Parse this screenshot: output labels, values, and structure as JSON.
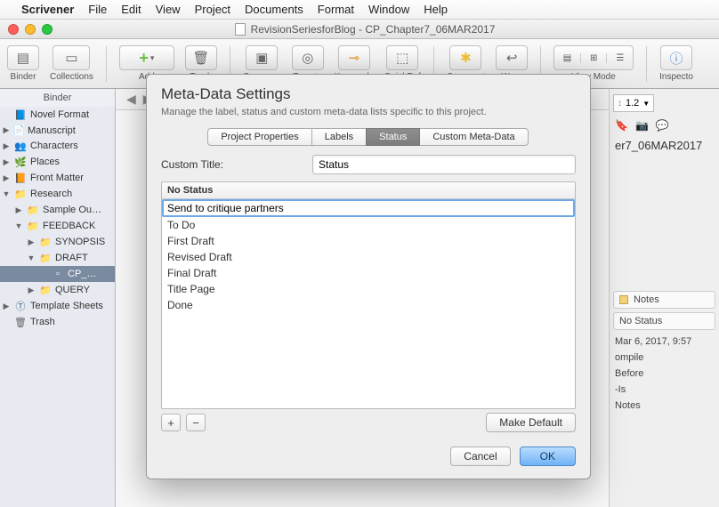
{
  "menubar": {
    "app": "Scrivener",
    "items": [
      "File",
      "Edit",
      "View",
      "Project",
      "Documents",
      "Format",
      "Window",
      "Help"
    ]
  },
  "window_title": "RevisionSeriesforBlog - CP_Chapter7_06MAR2017",
  "toolbar": {
    "binder": "Binder",
    "collections": "Collections",
    "add": "Add",
    "trash": "Trash",
    "compose": "Compose",
    "targets": "Targets",
    "keywords": "Keywords",
    "quickref": "QuickRef",
    "comment": "Comment",
    "wrap": "Wrap",
    "viewmode": "View Mode",
    "inspector": "Inspecto"
  },
  "binder": {
    "title": "Binder",
    "items": [
      {
        "lvl": 1,
        "disc": "",
        "icon": "book",
        "label": "Novel Format"
      },
      {
        "lvl": 1,
        "disc": "▶",
        "icon": "doc",
        "label": "Manuscript"
      },
      {
        "lvl": 1,
        "disc": "▶",
        "icon": "people",
        "label": "Characters"
      },
      {
        "lvl": 1,
        "disc": "▶",
        "icon": "green",
        "label": "Places"
      },
      {
        "lvl": 1,
        "disc": "▶",
        "icon": "orange",
        "label": "Front Matter"
      },
      {
        "lvl": 1,
        "disc": "▼",
        "icon": "folder",
        "label": "Research"
      },
      {
        "lvl": 2,
        "disc": "▶",
        "icon": "folder",
        "label": "Sample Ou…"
      },
      {
        "lvl": 2,
        "disc": "▼",
        "icon": "folder",
        "label": "FEEDBACK"
      },
      {
        "lvl": 3,
        "disc": "▶",
        "icon": "folder",
        "label": "SYNOPSIS"
      },
      {
        "lvl": 3,
        "disc": "▼",
        "icon": "folder",
        "label": "DRAFT"
      },
      {
        "lvl": 4,
        "disc": "",
        "icon": "docsel",
        "label": "CP_…",
        "sel": true
      },
      {
        "lvl": 3,
        "disc": "▶",
        "icon": "folder",
        "label": "QUERY"
      },
      {
        "lvl": 1,
        "disc": "▶",
        "icon": "t",
        "label": "Template Sheets"
      },
      {
        "lvl": 1,
        "disc": "",
        "icon": "trash",
        "label": "Trash"
      }
    ]
  },
  "inspector": {
    "zoom": "1.2",
    "doc_title": "er7_06MAR2017",
    "notes_label": "Notes",
    "status_label": "No Status",
    "meta": [
      "Mar 6, 2017, 9:57",
      "ompile",
      "Before",
      "‑Is",
      "Notes"
    ]
  },
  "dialog": {
    "title": "Meta-Data Settings",
    "subtitle": "Manage the label, status and custom meta-data lists specific to this project.",
    "tabs": [
      "Project Properties",
      "Labels",
      "Status",
      "Custom Meta-Data"
    ],
    "active_tab": 2,
    "custom_title_label": "Custom Title:",
    "custom_title_value": "Status",
    "list_header": "No Status",
    "editing_value": "Send to critique partners",
    "statuses": [
      "To Do",
      "First Draft",
      "Revised Draft",
      "Final Draft",
      "Title Page",
      "Done"
    ],
    "add": "+",
    "remove": "−",
    "make_default": "Make Default",
    "cancel": "Cancel",
    "ok": "OK"
  }
}
